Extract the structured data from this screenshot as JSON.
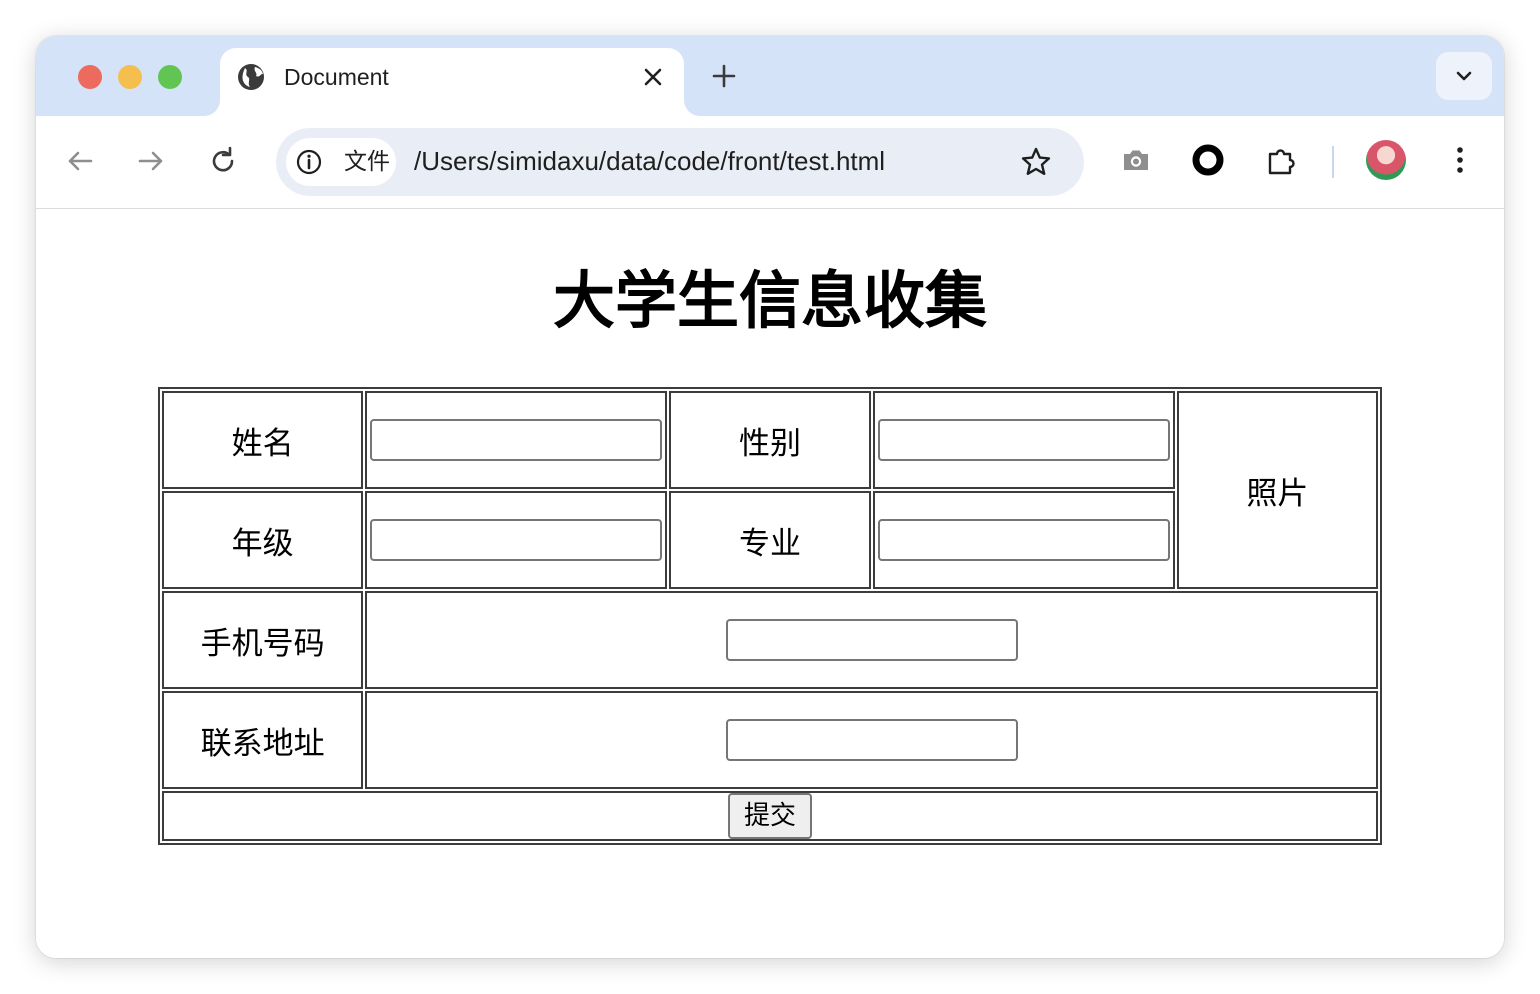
{
  "browser": {
    "tab": {
      "title": "Document"
    },
    "address_bar": {
      "chip_label": "文件",
      "url": "/Users/simidaxu/data/code/front/test.html"
    },
    "icons": {
      "back": "arrow-left-icon",
      "forward": "arrow-right-icon",
      "reload": "reload-icon",
      "info": "info-icon",
      "bookmark": "star-icon",
      "screenshot": "camera-icon",
      "extension_record": "ring-icon",
      "extensions": "puzzle-icon",
      "menu": "kebab-menu-icon"
    }
  },
  "page": {
    "title": "大学生信息收集",
    "form": {
      "name_label": "姓名",
      "gender_label": "性别",
      "photo_label": "照片",
      "grade_label": "年级",
      "major_label": "专业",
      "phone_label": "手机号码",
      "address_label": "联系地址",
      "submit_label": "提交",
      "values": {
        "name": "",
        "gender": "",
        "grade": "",
        "major": "",
        "phone": "",
        "address": ""
      }
    }
  },
  "colors": {
    "tabbar_bg": "#d5e3f8",
    "omnibox_bg": "#e9eef6",
    "table_border": "#3c3c3c"
  }
}
